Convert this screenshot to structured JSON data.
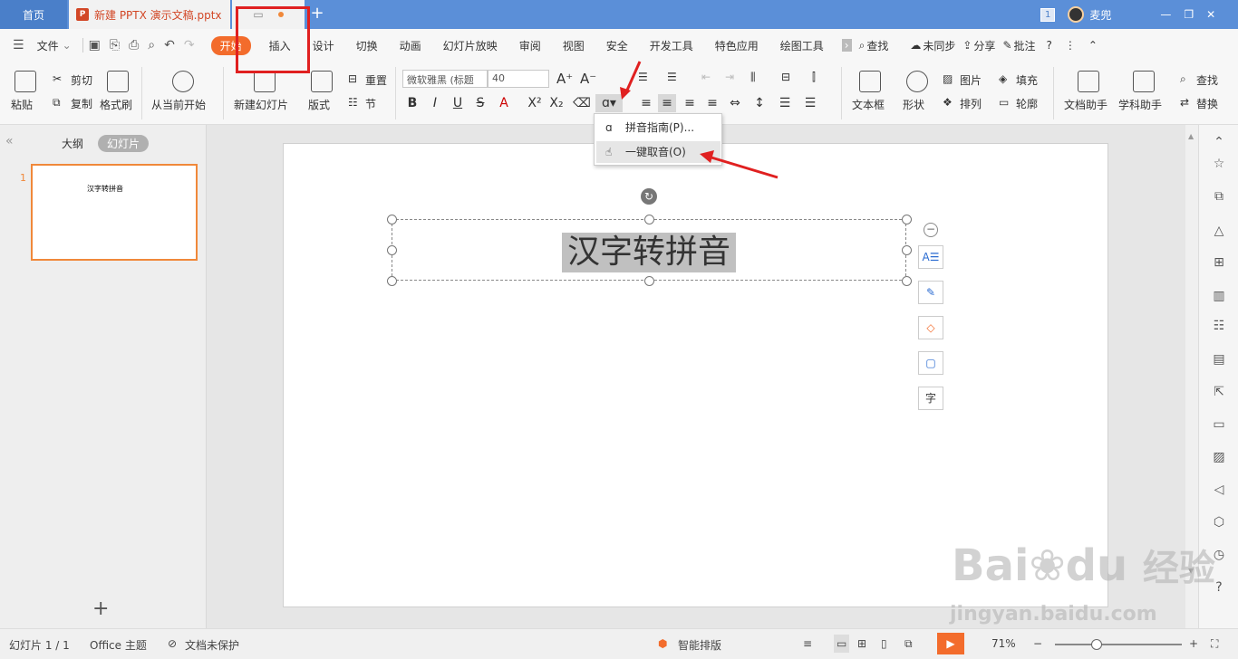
{
  "titlebar": {
    "home_tab": "首页",
    "doc_tab": "新建 PPTX 演示文稿.pptx",
    "doc_icon": "P",
    "add_tab": "+",
    "badge": "1",
    "user": "麦兜"
  },
  "menu": {
    "file": "文件",
    "items": [
      "开始",
      "插入",
      "设计",
      "切换",
      "动画",
      "幻灯片放映",
      "审阅",
      "视图",
      "安全",
      "开发工具",
      "特色应用",
      "绘图工具"
    ],
    "search": "查找",
    "sync": "未同步",
    "share": "分享",
    "comment": "批注",
    "help": "?"
  },
  "ribbon": {
    "paste": "粘贴",
    "cut": "剪切",
    "copy": "复制",
    "format_painter": "格式刷",
    "from_current": "从当前开始",
    "new_slide": "新建幻灯片",
    "layout": "版式",
    "reset": "重置",
    "section": "节",
    "font_name": "微软雅黑 (标题",
    "font_size": "40",
    "textbox": "文本框",
    "shape": "形状",
    "picture": "图片",
    "arrange": "排列",
    "fill": "填充",
    "outline": "轮廓",
    "doc_assistant": "文档助手",
    "subject_assistant": "学科助手",
    "find": "查找",
    "replace": "替换"
  },
  "dropdown": {
    "item1": "拼音指南(P)...",
    "item2": "一键取音(O)"
  },
  "leftpanel": {
    "outline": "大纲",
    "slides": "幻灯片",
    "slide_num": "1",
    "thumb_text": "汉字转拼音"
  },
  "slide": {
    "title": "汉字转拼音"
  },
  "status": {
    "slide_info": "幻灯片 1 / 1",
    "theme": "Office 主题",
    "protect": "文档未保护",
    "smart_layout": "智能排版",
    "zoom": "71%"
  },
  "watermark": {
    "brand": "Bai",
    "brand2": "du",
    "site": "经验",
    "url": "jingyan.baidu.com"
  },
  "colors": {
    "accent": "#f36c2c",
    "titlebar": "#5b8fd8",
    "annotation": "#e02020"
  }
}
